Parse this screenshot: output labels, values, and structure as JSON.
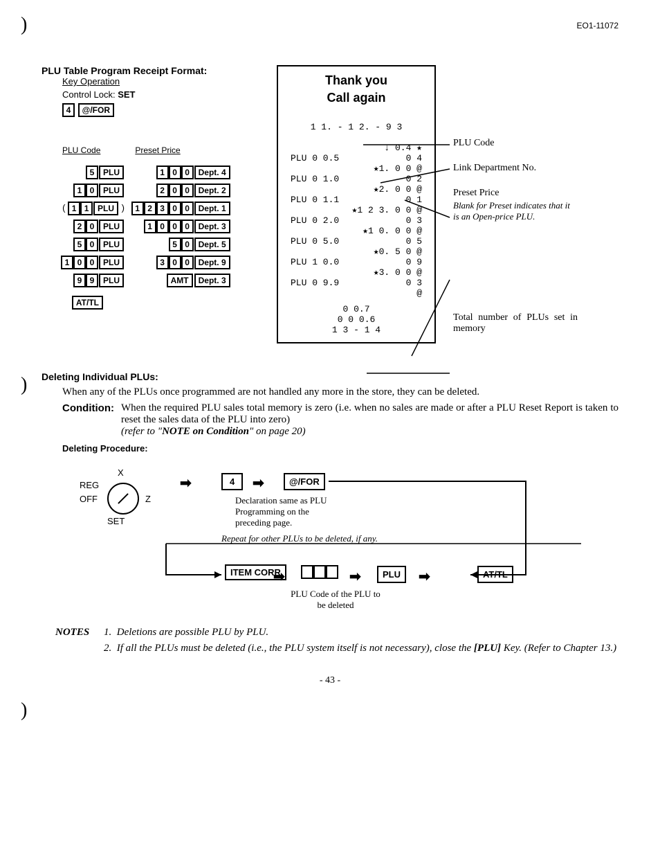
{
  "header_code": "EO1-11072",
  "section1_title": "PLU Table Program Receipt Format:",
  "key_op_label": "Key Operation",
  "control_lock": "Control Lock:",
  "control_lock_val": "SET",
  "key_4": "4",
  "key_atfor": "@/FOR",
  "plu_code_hdr": "PLU Code",
  "preset_price_hdr": "Preset Price",
  "keys": {
    "plu": "PLU",
    "amt": "AMT",
    "attl": "AT/TL",
    "dept1": "Dept. 1",
    "dept2": "Dept. 2",
    "dept3": "Dept. 3",
    "dept4": "Dept. 4",
    "dept5": "Dept. 5",
    "dept9": "Dept. 9",
    "itemcorr": "ITEM CORR"
  },
  "receipt": {
    "title1": "Thank you",
    "title2": "Call  again",
    "date": "1 1. - 1 2. - 9 3",
    "lines": [
      {
        "l": "",
        "r": "↓ 0.4 ★"
      },
      {
        "l": "PLU 0 0.5",
        "r": "0 4"
      },
      {
        "l": "",
        "r": "★1. 0 0    @"
      },
      {
        "l": "PLU 0 1.0",
        "r": "0 2"
      },
      {
        "l": "",
        "r": "★2. 0 0    @"
      },
      {
        "l": "PLU 0 1.1",
        "r": "0 1"
      },
      {
        "l": "",
        "r": "★1 2 3. 0 0    @"
      },
      {
        "l": "PLU 0 2.0",
        "r": "0 3"
      },
      {
        "l": "",
        "r": "★1 0. 0 0    @"
      },
      {
        "l": "PLU 0 5.0",
        "r": "0 5"
      },
      {
        "l": "",
        "r": "★0. 5 0    @"
      },
      {
        "l": "PLU 1 0.0",
        "r": "0 9"
      },
      {
        "l": "",
        "r": "★3. 0 0    @"
      },
      {
        "l": "PLU 0 9.9",
        "r": "0 3"
      },
      {
        "l": "",
        "r": "@"
      },
      {
        "l": "0 0.7",
        "r": ""
      },
      {
        "l": "0 0 0.6",
        "r": ""
      },
      {
        "l": "1 3 - 1 4",
        "r": ""
      }
    ]
  },
  "callouts": {
    "plu_code": "PLU Code",
    "link_dept": "Link Department No.",
    "preset_price": "Preset Price",
    "preset_note": "Blank for Preset indicates that it is an Open-price PLU.",
    "total": "Total number of PLUs set in memory"
  },
  "section2_title": "Deleting Individual PLUs:",
  "para1": "When any of the PLUs once programmed are not handled any more in the store, they can be deleted.",
  "cond_label": "Condition:",
  "cond_text": "When the required PLU sales total memory is zero (i.e. when no sales are made or after a PLU Reset Report is taken to reset the sales data of the PLU into zero)",
  "cond_ref": "(refer to \"NOTE on Condition\" on page 20)",
  "del_proc": "Deleting Procedure:",
  "dial": {
    "x": "X",
    "reg": "REG",
    "z": "Z",
    "off": "OFF",
    "set": "SET"
  },
  "flow_note1": "Declaration same as PLU Programming on the preceding page.",
  "flow_note2": "Repeat for other PLUs to be deleted, if any.",
  "flow_note3": "PLU Code of the PLU to be deleted",
  "notes_label": "NOTES",
  "note1_num": "1.",
  "note1": "Deletions are possible PLU by PLU.",
  "note2_num": "2.",
  "note2a": "If all the PLUs must be deleted (i.e., the PLU system itself is not necessary), close the ",
  "note2b": "[PLU]",
  "note2c": " Key.  (Refer to Chapter 13.)",
  "page_num": "- 43 -"
}
